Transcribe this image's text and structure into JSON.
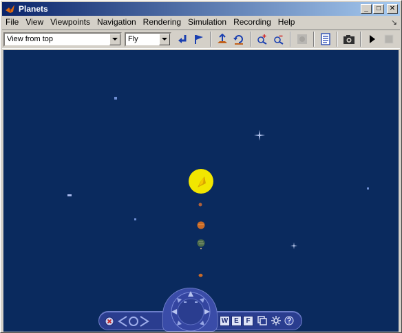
{
  "window": {
    "title": "Planets",
    "buttons": {
      "minimize": "_",
      "maximize": "□",
      "close": "✕"
    }
  },
  "menu": {
    "items": [
      "File",
      "View",
      "Viewpoints",
      "Navigation",
      "Rendering",
      "Simulation",
      "Recording",
      "Help"
    ],
    "resize_glyph": "↘"
  },
  "toolbar": {
    "viewpoint_select": {
      "value": "View from top"
    },
    "navmode_select": {
      "value": "Fly"
    },
    "icons": [
      "return-icon",
      "viewpoint-flag-icon",
      "go-to-viewpoint-icon",
      "straighten-up-icon",
      "zoom-in-icon",
      "zoom-out-icon",
      "record-icon",
      "copy-view-icon",
      "snapshot-icon",
      "play-icon",
      "stop-icon"
    ]
  },
  "navigation_panel": {
    "letters": [
      "W",
      "E",
      "F"
    ],
    "icons": [
      "close-panel-icon",
      "back-arrow-icon",
      "circle-icon",
      "forward-arrow-icon",
      "compass-dial-icon",
      "copy-icon",
      "settings-icon",
      "help-icon"
    ]
  },
  "colors": {
    "titlebar_start": "#0a246a",
    "titlebar_end": "#a6caf0",
    "viewport_background": "#0a2a5e",
    "sun": "#f2e600",
    "nav_panel": "#2a3d8f"
  }
}
